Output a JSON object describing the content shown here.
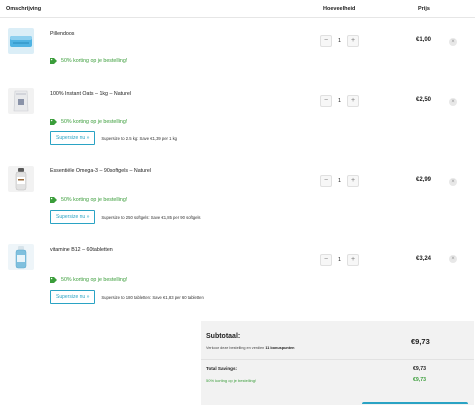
{
  "header": {
    "description": "Omschrijving",
    "quantity": "Hoeveelheid",
    "price": "Prijs"
  },
  "items": [
    {
      "name": "Pillendoos",
      "quantity": "1",
      "price": "€1,00",
      "promo": "50% korting op je bestelling!",
      "thumb_icon": "pill-box-icon"
    },
    {
      "name": "100% Instant Oats – 1kg – Naturel",
      "quantity": "1",
      "price": "€2,50",
      "promo": "50% korting op je bestelling!",
      "upsell_button": "Supersize nu »",
      "upsell_note": "Supersize to 2.5 kg: Save €1,39 per 1 kg",
      "thumb_icon": "oats-bag-icon"
    },
    {
      "name": "Essentiële Omega-3 – 90softgels – Naturel",
      "quantity": "1",
      "price": "€2,99",
      "promo": "50% korting op je bestelling!",
      "upsell_button": "Supersize nu »",
      "upsell_note": "Supersize to 250 softgels: Save €1,85 per 90 softgels",
      "thumb_icon": "omega-bottle-icon"
    },
    {
      "name": "vitamine B12 – 60tabletten",
      "quantity": "1",
      "price": "€3,24",
      "promo": "50% korting op je bestelling!",
      "upsell_button": "Supersize nu »",
      "upsell_note": "Supersize to 180 tabletten: Save €1,83 per 60 tabletten",
      "thumb_icon": "vitamin-bottle-icon"
    }
  ],
  "stepper": {
    "minus": "−",
    "plus": "+"
  },
  "remove_icon": "×",
  "summary": {
    "subtotal_label": "Subtotaal:",
    "subtotal_value": "€9,73",
    "points_prefix": "Verkoor deze bestelling en verdien",
    "points_value": "11 bonuspunten",
    "savings_label": "Total Savings:",
    "savings_value": "€9,73",
    "savings_item_label": "50% korting op je bestelling!",
    "savings_item_value": "€9,73"
  },
  "colors": {
    "accent": "#2aa3c4",
    "promo_green": "#3a9d3a",
    "summary_bg": "#f2f2f2"
  }
}
